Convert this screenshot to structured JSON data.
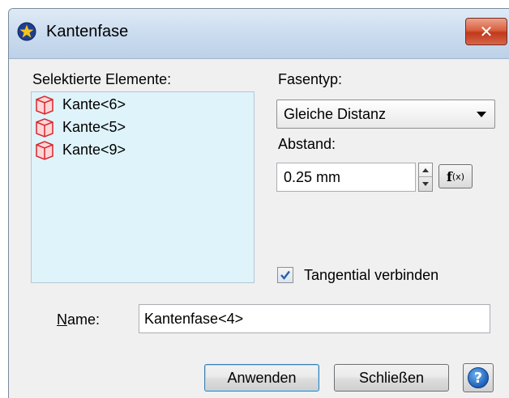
{
  "window": {
    "title": "Kantenfase",
    "close_glyph": "✕"
  },
  "selected_elements": {
    "label": "Selektierte Elemente:",
    "items": [
      {
        "label": "Kante<6>",
        "icon": "edge-cube-icon"
      },
      {
        "label": "Kante<5>",
        "icon": "edge-cube-icon"
      },
      {
        "label": "Kante<9>",
        "icon": "edge-cube-icon"
      }
    ]
  },
  "chamfer_type": {
    "label": "Fasentyp:",
    "selected": "Gleiche Distanz"
  },
  "distance": {
    "label": "Abstand:",
    "value": "0.25 mm",
    "fx_main": "f",
    "fx_sub": "(x)"
  },
  "tangential": {
    "label": "Tangential verbinden",
    "checked": true
  },
  "name": {
    "label_first": "N",
    "label_rest": "ame:",
    "value": "Kantenfase<4>"
  },
  "buttons": {
    "apply": "Anwenden",
    "close": "Schließen",
    "help_glyph": "?"
  },
  "colors": {
    "list_background": "#dff3fa",
    "close_button": "#c0391b",
    "cube_edge": "#d9262f"
  }
}
